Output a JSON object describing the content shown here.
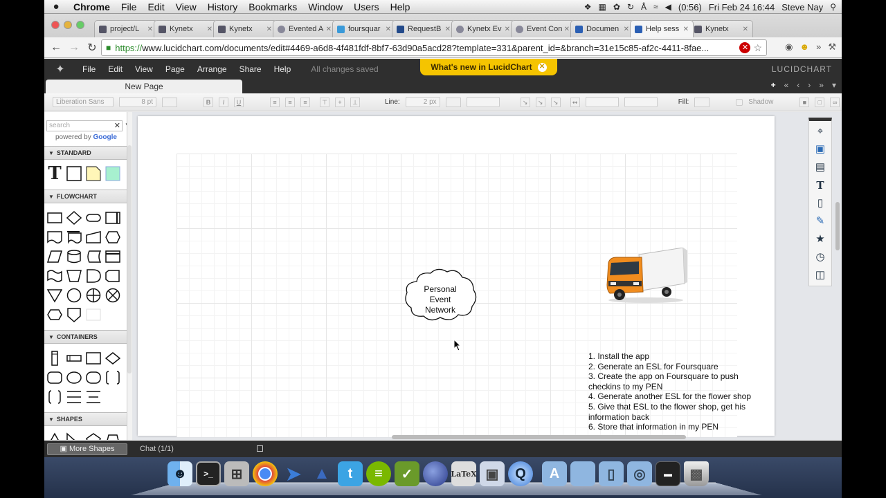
{
  "menubar": {
    "apple": "",
    "app_name": "Chrome",
    "items": [
      "File",
      "Edit",
      "View",
      "History",
      "Bookmarks",
      "Window",
      "Users",
      "Help"
    ],
    "battery": "(0:56)",
    "clock": "Fri Feb 24  16:44",
    "user": "Steve Nay"
  },
  "browser": {
    "tabs": [
      {
        "title": "project/L",
        "active": false
      },
      {
        "title": "Kynetx",
        "active": false
      },
      {
        "title": "Kynetx",
        "active": false
      },
      {
        "title": "Evented A",
        "active": false
      },
      {
        "title": "foursquar",
        "active": false
      },
      {
        "title": "RequestB",
        "active": false
      },
      {
        "title": "Kynetx Ev",
        "active": false
      },
      {
        "title": "Event Con",
        "active": false
      },
      {
        "title": "Documen",
        "active": false
      },
      {
        "title": "Help sess",
        "active": true
      },
      {
        "title": "Kynetx",
        "active": false
      }
    ],
    "url_scheme": "https://",
    "url_rest": "www.lucidchart.com/documents/edit#4469-a6d8-4f481fdf-8bf7-63d90a5acd28?template=331&parent_id=&branch=31e15c85-af2c-4411-8fae..."
  },
  "app": {
    "menu": [
      "File",
      "Edit",
      "View",
      "Page",
      "Arrange",
      "Share",
      "Help"
    ],
    "save_status": "All changes saved",
    "whats_new": "What's new in LucidChart",
    "brand": "LUCIDCHART",
    "page_tab": "New Page"
  },
  "format": {
    "font": "Liberation Sans",
    "font_size": "8 pt",
    "line_label": "Line:",
    "line_width": "2 px",
    "fill_label": "Fill:",
    "shadow_label": "Shadow"
  },
  "panel": {
    "search_placeholder": "search",
    "powered_by": "powered by",
    "google": "Google",
    "sections": [
      "STANDARD",
      "FLOWCHART",
      "CONTAINERS",
      "SHAPES"
    ],
    "more_shapes": "More Shapes"
  },
  "canvas": {
    "cloud_label": [
      "Personal",
      "Event",
      "Network"
    ],
    "steps": [
      "1. Install the app",
      "2. Generate an ESL for Foursquare",
      "3. Create the app on Foursquare to push checkins to my PEN",
      "4. Generate another ESL for the flower shop",
      "5. Give that ESL to the flower shop, get his information back",
      "6. Store that information in my PEN"
    ]
  },
  "chat": {
    "label": "Chat (1/1)"
  },
  "colors": {
    "accent": "#f5c400",
    "header": "#2f2f2f"
  }
}
